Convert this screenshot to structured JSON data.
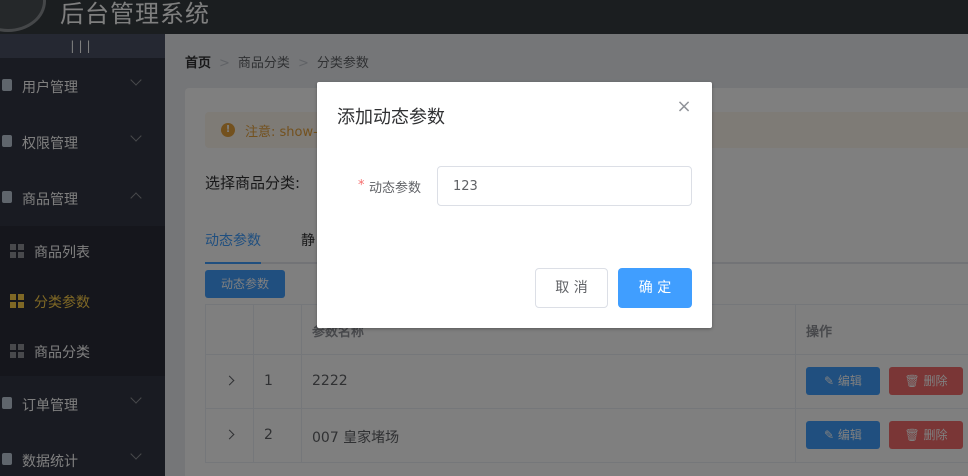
{
  "header": {
    "title": "后台管理系统"
  },
  "sidebar": {
    "toggle": "|||",
    "menu": [
      {
        "label": "用户管理",
        "icon": "user-icon"
      },
      {
        "label": "权限管理",
        "icon": "lock-icon"
      },
      {
        "label": "商品管理",
        "icon": "goods-icon"
      },
      {
        "label": "订单管理",
        "icon": "order-icon"
      },
      {
        "label": "数据统计",
        "icon": "chart-icon"
      }
    ],
    "submenu": [
      {
        "label": "商品列表"
      },
      {
        "label": "分类参数",
        "active": true
      },
      {
        "label": "商品分类"
      }
    ]
  },
  "breadcrumb": [
    "首页",
    "商品分类",
    "分类参数"
  ],
  "alert": {
    "icon": "!",
    "text": "注意: show-"
  },
  "category_select": {
    "label": "选择商品分类:"
  },
  "tabs": [
    {
      "label": "动态参数",
      "active": true
    },
    {
      "label": "静"
    }
  ],
  "add_button": "动态参数",
  "table": {
    "header": {
      "name": "参数名称",
      "ops": "操作"
    },
    "rows": [
      {
        "index": "1",
        "name": "2222"
      },
      {
        "index": "2",
        "name": "007 皇家堵场"
      }
    ],
    "edit_label": "编辑",
    "delete_label": "删除"
  },
  "dialog": {
    "title": "添加动态参数",
    "close": "×",
    "required_mark": "*",
    "field_label": "动态参数",
    "field_value": "123",
    "cancel": "取 消",
    "confirm": "确 定"
  },
  "colors": {
    "primary": "#409eff",
    "danger": "#f56c6c",
    "warning": "#e6a23c",
    "sidebar_bg": "#333744",
    "header_bg": "#373d41",
    "active_menu": "#ffd04b"
  }
}
